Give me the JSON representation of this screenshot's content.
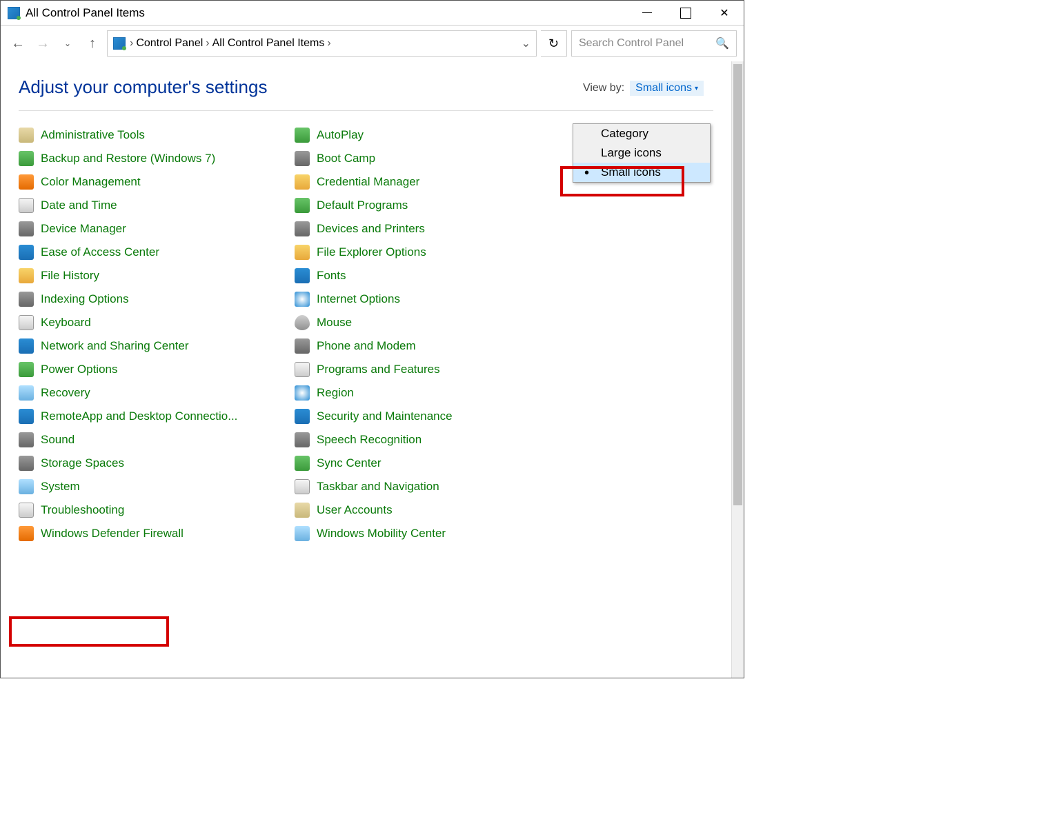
{
  "window": {
    "title": "All Control Panel Items"
  },
  "breadcrumbs": {
    "part1": "Control Panel",
    "part2": "All Control Panel Items"
  },
  "search": {
    "placeholder": "Search Control Panel"
  },
  "page": {
    "heading": "Adjust your computer's settings"
  },
  "viewby": {
    "label": "View by:",
    "selected": "Small icons"
  },
  "viewmenu": {
    "opt1": "Category",
    "opt2": "Large icons",
    "opt3": "Small icons"
  },
  "col1": [
    {
      "label": "Administrative Tools",
      "ic": "ic1"
    },
    {
      "label": "Backup and Restore (Windows 7)",
      "ic": "ic2"
    },
    {
      "label": "Color Management",
      "ic": "ic3"
    },
    {
      "label": "Date and Time",
      "ic": "ic4"
    },
    {
      "label": "Device Manager",
      "ic": "ic5"
    },
    {
      "label": "Ease of Access Center",
      "ic": "ic6"
    },
    {
      "label": "File History",
      "ic": "ic7"
    },
    {
      "label": "Indexing Options",
      "ic": "ic5"
    },
    {
      "label": "Keyboard",
      "ic": "ic4"
    },
    {
      "label": "Network and Sharing Center",
      "ic": "ic6"
    },
    {
      "label": "Power Options",
      "ic": "ic2"
    },
    {
      "label": "Recovery",
      "ic": "ic9"
    },
    {
      "label": "RemoteApp and Desktop Connectio...",
      "ic": "ic6"
    },
    {
      "label": "Sound",
      "ic": "ic5"
    },
    {
      "label": "Storage Spaces",
      "ic": "ic5"
    },
    {
      "label": "System",
      "ic": "ic9"
    },
    {
      "label": "Troubleshooting",
      "ic": "ic4"
    },
    {
      "label": "Windows Defender Firewall",
      "ic": "ic3"
    }
  ],
  "col2": [
    {
      "label": "AutoPlay",
      "ic": "ic2"
    },
    {
      "label": "Boot Camp",
      "ic": "ic5"
    },
    {
      "label": "Credential Manager",
      "ic": "ic7"
    },
    {
      "label": "Default Programs",
      "ic": "ic2"
    },
    {
      "label": "Devices and Printers",
      "ic": "ic5"
    },
    {
      "label": "File Explorer Options",
      "ic": "ic7"
    },
    {
      "label": "Fonts",
      "ic": "ic6"
    },
    {
      "label": "Internet Options",
      "ic": "ic8"
    },
    {
      "label": "Mouse",
      "ic": "ic10"
    },
    {
      "label": "Phone and Modem",
      "ic": "ic5"
    },
    {
      "label": "Programs and Features",
      "ic": "ic4"
    },
    {
      "label": "Region",
      "ic": "ic8"
    },
    {
      "label": "Security and Maintenance",
      "ic": "ic6"
    },
    {
      "label": "Speech Recognition",
      "ic": "ic5"
    },
    {
      "label": "Sync Center",
      "ic": "ic2"
    },
    {
      "label": "Taskbar and Navigation",
      "ic": "ic4"
    },
    {
      "label": "User Accounts",
      "ic": "ic1"
    },
    {
      "label": "Windows Mobility Center",
      "ic": "ic9"
    }
  ]
}
